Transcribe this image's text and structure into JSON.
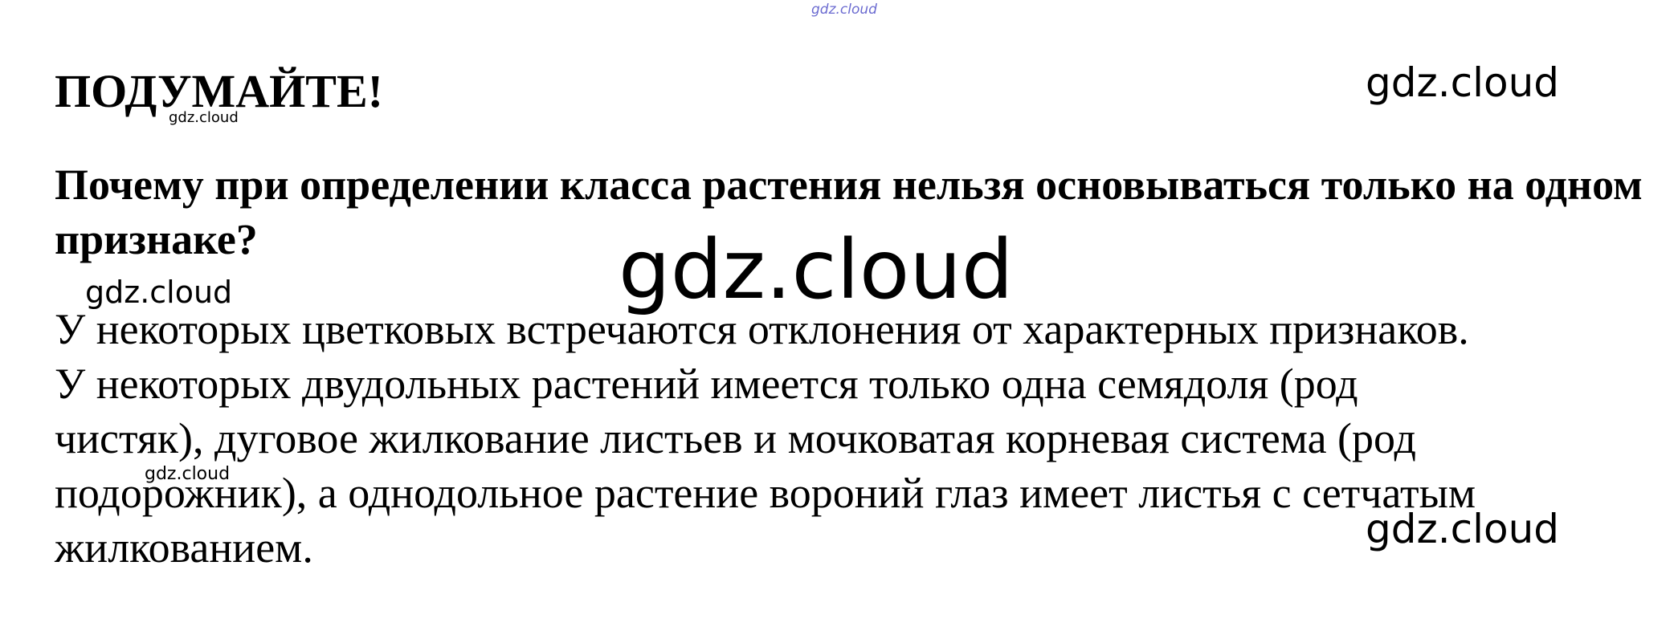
{
  "document": {
    "heading": "ПОДУМАЙТЕ!",
    "question": "Почему при определении класса растения нельзя основываться только на одном признаке?",
    "answer_lines": [
      "У некоторых цветковых встречаются отклонения от характерных признаков.",
      "У некоторых двудольных растений имеется только одна семядоля (род",
      "чистяк), дуговое жилкование листьев и мочковатая корневая система (род",
      "подорожник), а однодольное растение вороний глаз имеет листья с сетчатым",
      "жилкованием."
    ]
  },
  "watermarks": {
    "top": "gdz.cloud",
    "a": "gdz.cloud",
    "b": "gdz.cloud",
    "big": "gdz.cloud",
    "c": "gdz.cloud",
    "d": "gdz.cloud",
    "e": "gdz.cloud"
  },
  "colors": {
    "text": "#000000",
    "background": "#ffffff",
    "top_watermark": "#6a6ad0"
  }
}
